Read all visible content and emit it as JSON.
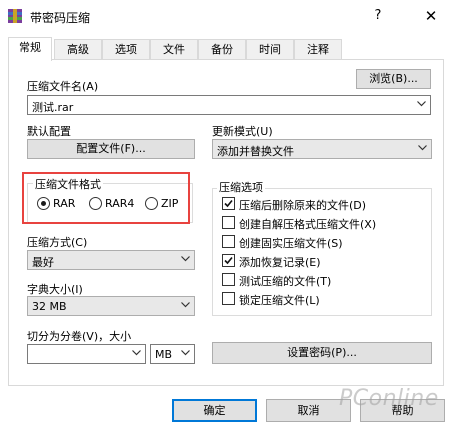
{
  "window": {
    "title": "带密码压缩",
    "help_glyph": "?",
    "close_glyph": "✕"
  },
  "tabs": [
    {
      "label": "常规",
      "active": true
    },
    {
      "label": "高级"
    },
    {
      "label": "选项"
    },
    {
      "label": "文件"
    },
    {
      "label": "备份"
    },
    {
      "label": "时间"
    },
    {
      "label": "注释"
    }
  ],
  "archive": {
    "name_label": "压缩文件名(A)",
    "browse_label": "浏览(B)...",
    "name_value": "测试.rar"
  },
  "profile": {
    "label": "默认配置",
    "button_label": "配置文件(F)..."
  },
  "update_mode": {
    "label": "更新模式(U)",
    "value": "添加并替换文件"
  },
  "format": {
    "title": "压缩文件格式",
    "options": [
      {
        "label": "RAR",
        "selected": true
      },
      {
        "label": "RAR4",
        "selected": false
      },
      {
        "label": "ZIP",
        "selected": false
      }
    ]
  },
  "method": {
    "label": "压缩方式(C)",
    "value": "最好"
  },
  "dictionary": {
    "label": "字典大小(I)",
    "value": "32 MB"
  },
  "split": {
    "label": "切分为分卷(V)，大小",
    "size_value": "",
    "unit_value": "MB"
  },
  "options": {
    "title": "压缩选项",
    "items": [
      {
        "label": "压缩后删除原来的文件(D)",
        "checked": true
      },
      {
        "label": "创建自解压格式压缩文件(X)",
        "checked": false
      },
      {
        "label": "创建固实压缩文件(S)",
        "checked": false
      },
      {
        "label": "添加恢复记录(E)",
        "checked": true
      },
      {
        "label": "测试压缩的文件(T)",
        "checked": false
      },
      {
        "label": "锁定压缩文件(L)",
        "checked": false
      }
    ]
  },
  "password_button_label": "设置密码(P)...",
  "footer": {
    "ok_label": "确定",
    "cancel_label": "取消",
    "help_label": "帮助"
  },
  "watermark": "PConline",
  "colors": {
    "highlight": "#e8433f",
    "default_button_border": "#0078d7",
    "button_bg": "#e1e1e1"
  }
}
